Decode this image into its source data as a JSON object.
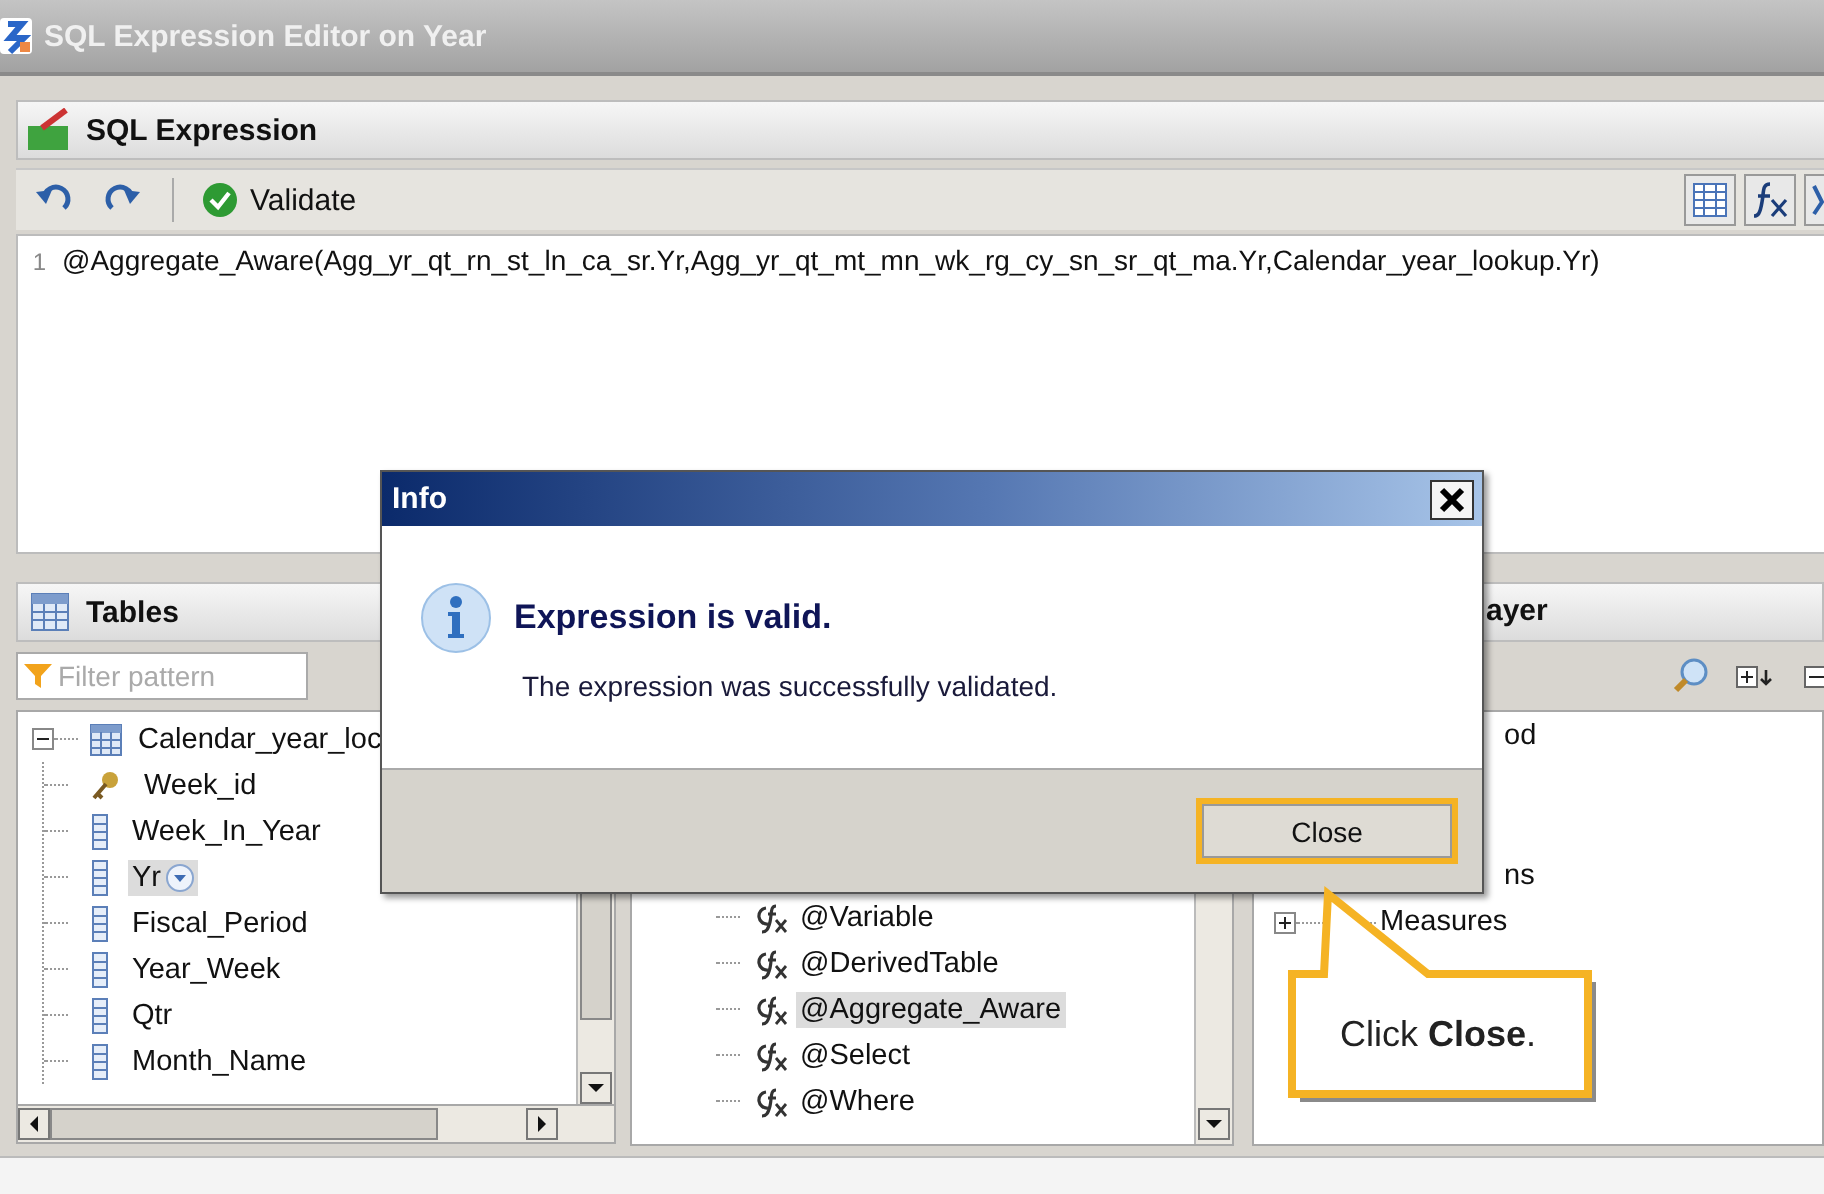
{
  "window": {
    "title": "SQL Expression Editor on Year"
  },
  "expression_panel": {
    "title": "SQL Expression",
    "validate_label": "Validate",
    "lines": [
      {
        "number": "1",
        "text": "@Aggregate_Aware(Agg_yr_qt_rn_st_ln_ca_sr.Yr,Agg_yr_qt_mt_mn_wk_rg_cy_sn_sr_qt_ma.Yr,Calendar_year_lookup.Yr)"
      }
    ]
  },
  "tables_panel": {
    "title": "Tables",
    "filter": {
      "placeholder": "Filter pattern"
    },
    "tree": [
      {
        "label": "Calendar_year_loc",
        "kind": "table",
        "expanded": true,
        "selected": false,
        "children": [
          {
            "label": "Week_id",
            "kind": "key",
            "selected": false
          },
          {
            "label": "Week_In_Year",
            "kind": "column",
            "selected": false
          },
          {
            "label": "Yr",
            "kind": "column",
            "selected": true
          },
          {
            "label": "Fiscal_Period",
            "kind": "column",
            "selected": false
          },
          {
            "label": "Year_Week",
            "kind": "column",
            "selected": false
          },
          {
            "label": "Qtr",
            "kind": "column",
            "selected": false
          },
          {
            "label": "Month_Name",
            "kind": "column",
            "selected": false
          }
        ]
      }
    ]
  },
  "functions_panel": {
    "items": [
      {
        "label": "@Variable",
        "selected": false
      },
      {
        "label": "@DerivedTable",
        "selected": false
      },
      {
        "label": "@Aggregate_Aware",
        "selected": true
      },
      {
        "label": "@Select",
        "selected": false
      },
      {
        "label": "@Where",
        "selected": false
      }
    ]
  },
  "right_panel": {
    "title": "ayer",
    "items": [
      {
        "label": "od",
        "expandable": false
      },
      {
        "label": "ns",
        "expandable": false
      },
      {
        "label": "Measures",
        "expandable": true
      }
    ]
  },
  "dialog": {
    "title": "Info",
    "heading": "Expression is valid.",
    "message": "The expression was successfully validated.",
    "button": "Close"
  },
  "callout": {
    "text": "Click **Close**."
  }
}
